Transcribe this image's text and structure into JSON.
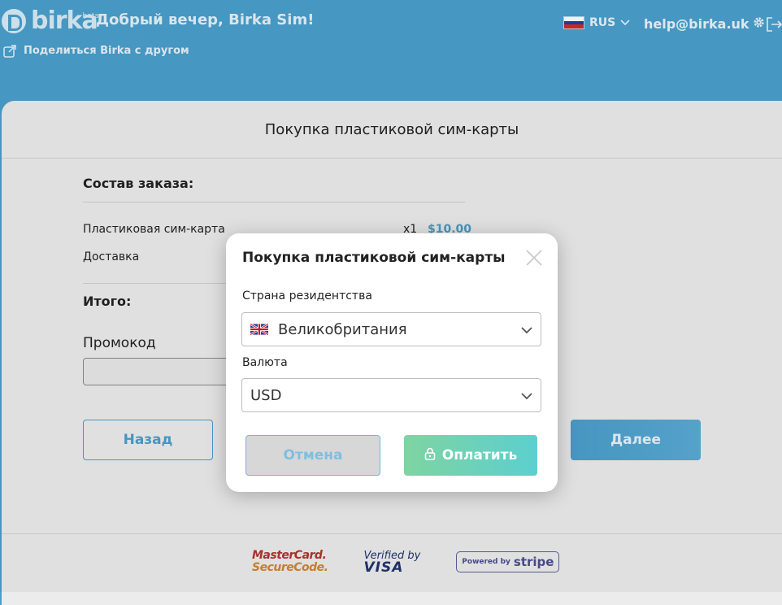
{
  "brand": {
    "name": "birka",
    "badge": "beta"
  },
  "header": {
    "greeting": "Добрый вечер, Birka Sim!",
    "share_label": "Поделиться Birka с другом",
    "language": "RUS",
    "email": "help@birka.uk"
  },
  "page": {
    "title": "Покупка пластиковой сим-карты",
    "order_heading": "Состав заказа:",
    "items": [
      {
        "name": "Пластиковая сим-карта",
        "qty": "x1",
        "price": "$10.00"
      },
      {
        "name": "Доставка",
        "qty": "",
        "price": ""
      }
    ],
    "total_label": "Итого:",
    "promo_label": "Промокод",
    "promo_value": "",
    "back_label": "Назад",
    "next_label": "Далее"
  },
  "payment_logos": {
    "mastercard_line1": "MasterCard.",
    "mastercard_line2": "SecureCode.",
    "visa_line1": "Verified by",
    "visa_line2": "VISA",
    "stripe_line1": "Powered by",
    "stripe_line2": "stripe"
  },
  "modal": {
    "title": "Покупка пластиковой сим-карты",
    "country_label": "Страна резидентства",
    "country_value": "Великобритания",
    "currency_label": "Валюта",
    "currency_value": "USD",
    "cancel_label": "Отмена",
    "pay_label": "Оплатить"
  },
  "colors": {
    "primary": "#4aa0cd",
    "card_bg": "#ececec",
    "pay_gradient_start": "#7fd4a1",
    "pay_gradient_end": "#5ccfcf"
  },
  "icons": [
    "share-icon",
    "chevron-down-icon",
    "gear-icon",
    "logout-icon",
    "close-icon",
    "lock-icon",
    "flag-uk-icon",
    "flag-ru-icon"
  ]
}
